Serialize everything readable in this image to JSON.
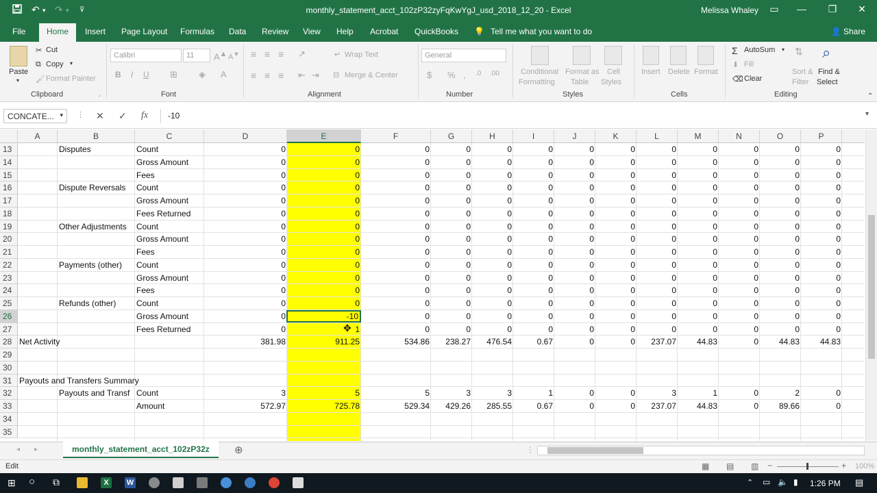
{
  "titlebar": {
    "title": "monthly_statement_acct_102zP32zyFqKwYgJ_usd_2018_12_20  -  Excel",
    "user": "Melissa Whaley",
    "save_icon": "save-icon",
    "undo_icon": "undo-icon",
    "redo_icon": "redo-icon"
  },
  "ribbon_tabs": [
    "File",
    "Home",
    "Insert",
    "Page Layout",
    "Formulas",
    "Data",
    "Review",
    "View",
    "Help",
    "Acrobat",
    "QuickBooks",
    "Tell me what you want to do",
    "Share"
  ],
  "ribbon": {
    "paste": "Paste",
    "cut": "Cut",
    "copy": "Copy",
    "format_painter": "Format Painter",
    "font_name": "Calibri",
    "font_size": "11",
    "wrap_text": "Wrap Text",
    "merge_center": "Merge & Center",
    "number_format": "General",
    "conditional_formatting": [
      "Conditional",
      "Formatting"
    ],
    "format_as_table": [
      "Format as",
      "Table"
    ],
    "cell_styles": [
      "Cell",
      "Styles"
    ],
    "insert": "Insert",
    "delete": "Delete",
    "format": "Format",
    "autosum": "AutoSum",
    "fill": "Fill",
    "clear": "Clear",
    "sort_filter": [
      "Sort &",
      "Filter"
    ],
    "find_select": [
      "Find &",
      "Select"
    ],
    "groups": [
      "Clipboard",
      "Font",
      "Alignment",
      "Number",
      "Styles",
      "Cells",
      "Editing"
    ]
  },
  "formula_bar": {
    "name_box": "CONCATE...",
    "formula": "-10"
  },
  "columns": [
    "A",
    "B",
    "C",
    "D",
    "E",
    "F",
    "G",
    "H",
    "I",
    "J",
    "K",
    "L",
    "M",
    "N",
    "O",
    "P"
  ],
  "rows": [
    {
      "n": "13",
      "A": "",
      "B": "Disputes",
      "C": "Count",
      "vals": [
        "0",
        "0",
        "0",
        "0",
        "0",
        "0",
        "0",
        "0",
        "0",
        "0",
        "0",
        "0",
        "0"
      ]
    },
    {
      "n": "14",
      "A": "",
      "B": "",
      "C": "Gross Amount",
      "vals": [
        "0",
        "0",
        "0",
        "0",
        "0",
        "0",
        "0",
        "0",
        "0",
        "0",
        "0",
        "0",
        "0"
      ]
    },
    {
      "n": "15",
      "A": "",
      "B": "",
      "C": "Fees",
      "vals": [
        "0",
        "0",
        "0",
        "0",
        "0",
        "0",
        "0",
        "0",
        "0",
        "0",
        "0",
        "0",
        "0"
      ]
    },
    {
      "n": "16",
      "A": "",
      "B": "Dispute Reversals",
      "C": "Count",
      "vals": [
        "0",
        "0",
        "0",
        "0",
        "0",
        "0",
        "0",
        "0",
        "0",
        "0",
        "0",
        "0",
        "0"
      ]
    },
    {
      "n": "17",
      "A": "",
      "B": "",
      "C": "Gross Amount",
      "vals": [
        "0",
        "0",
        "0",
        "0",
        "0",
        "0",
        "0",
        "0",
        "0",
        "0",
        "0",
        "0",
        "0"
      ]
    },
    {
      "n": "18",
      "A": "",
      "B": "",
      "C": "Fees Returned",
      "vals": [
        "0",
        "0",
        "0",
        "0",
        "0",
        "0",
        "0",
        "0",
        "0",
        "0",
        "0",
        "0",
        "0"
      ]
    },
    {
      "n": "19",
      "A": "",
      "B": "Other Adjustments",
      "C": "Count",
      "vals": [
        "0",
        "0",
        "0",
        "0",
        "0",
        "0",
        "0",
        "0",
        "0",
        "0",
        "0",
        "0",
        "0"
      ]
    },
    {
      "n": "20",
      "A": "",
      "B": "",
      "C": "Gross Amount",
      "vals": [
        "0",
        "0",
        "0",
        "0",
        "0",
        "0",
        "0",
        "0",
        "0",
        "0",
        "0",
        "0",
        "0"
      ]
    },
    {
      "n": "21",
      "A": "",
      "B": "",
      "C": "Fees",
      "vals": [
        "0",
        "0",
        "0",
        "0",
        "0",
        "0",
        "0",
        "0",
        "0",
        "0",
        "0",
        "0",
        "0"
      ]
    },
    {
      "n": "22",
      "A": "",
      "B": "Payments (other)",
      "C": "Count",
      "vals": [
        "0",
        "0",
        "0",
        "0",
        "0",
        "0",
        "0",
        "0",
        "0",
        "0",
        "0",
        "0",
        "0"
      ]
    },
    {
      "n": "23",
      "A": "",
      "B": "",
      "C": "Gross Amount",
      "vals": [
        "0",
        "0",
        "0",
        "0",
        "0",
        "0",
        "0",
        "0",
        "0",
        "0",
        "0",
        "0",
        "0"
      ]
    },
    {
      "n": "24",
      "A": "",
      "B": "",
      "C": "Fees",
      "vals": [
        "0",
        "0",
        "0",
        "0",
        "0",
        "0",
        "0",
        "0",
        "0",
        "0",
        "0",
        "0",
        "0"
      ]
    },
    {
      "n": "25",
      "A": "",
      "B": "Refunds (other)",
      "C": "Count",
      "vals": [
        "0",
        "0",
        "0",
        "0",
        "0",
        "0",
        "0",
        "0",
        "0",
        "0",
        "0",
        "0",
        "0"
      ]
    },
    {
      "n": "26",
      "A": "",
      "B": "",
      "C": "Gross Amount",
      "vals": [
        "0",
        "-10",
        "0",
        "0",
        "0",
        "0",
        "0",
        "0",
        "0",
        "0",
        "0",
        "0",
        "0"
      ]
    },
    {
      "n": "27",
      "A": "",
      "B": "",
      "C": "Fees Returned",
      "vals": [
        "0",
        "1",
        "0",
        "0",
        "0",
        "0",
        "0",
        "0",
        "0",
        "0",
        "0",
        "0",
        "0"
      ]
    },
    {
      "n": "28",
      "A": "Net Activity",
      "B": "",
      "C": "",
      "vals": [
        "381.98",
        "911.25",
        "534.86",
        "238.27",
        "476.54",
        "0.67",
        "0",
        "0",
        "237.07",
        "44.83",
        "0",
        "44.83",
        "44.83"
      ]
    },
    {
      "n": "29",
      "A": "",
      "B": "",
      "C": "",
      "vals": [
        "",
        "",
        "",
        "",
        "",
        "",
        "",
        "",
        "",
        "",
        "",
        "",
        ""
      ]
    },
    {
      "n": "30",
      "A": "",
      "B": "",
      "C": "",
      "vals": [
        "",
        "",
        "",
        "",
        "",
        "",
        "",
        "",
        "",
        "",
        "",
        "",
        ""
      ]
    },
    {
      "n": "31",
      "A": "Payouts and Transfers Summary",
      "B": "",
      "C": "",
      "vals": [
        "",
        "",
        "",
        "",
        "",
        "",
        "",
        "",
        "",
        "",
        "",
        "",
        ""
      ]
    },
    {
      "n": "32",
      "A": "",
      "B": "Payouts and Transf",
      "C": "Count",
      "vals": [
        "3",
        "5",
        "5",
        "3",
        "3",
        "1",
        "0",
        "0",
        "3",
        "1",
        "0",
        "2",
        "0"
      ]
    },
    {
      "n": "33",
      "A": "",
      "B": "",
      "C": "Amount",
      "vals": [
        "572.97",
        "725.78",
        "529.34",
        "429.26",
        "285.55",
        "0.67",
        "0",
        "0",
        "237.07",
        "44.83",
        "0",
        "89.66",
        "0"
      ]
    },
    {
      "n": "34",
      "A": "",
      "B": "",
      "C": "",
      "vals": [
        "",
        "",
        "",
        "",
        "",
        "",
        "",
        "",
        "",
        "",
        "",
        "",
        ""
      ]
    },
    {
      "n": "35",
      "A": "",
      "B": "",
      "C": "",
      "vals": [
        "",
        "",
        "",
        "",
        "",
        "",
        "",
        "",
        "",
        "",
        "",
        "",
        ""
      ]
    }
  ],
  "sheet_tab": "monthly_statement_acct_102zP32z",
  "status": {
    "mode": "Edit",
    "zoom": "100%"
  },
  "taskbar": {
    "time": "1:26 PM"
  },
  "colors": {
    "excel_green": "#217346",
    "highlight": "#ffff00"
  }
}
